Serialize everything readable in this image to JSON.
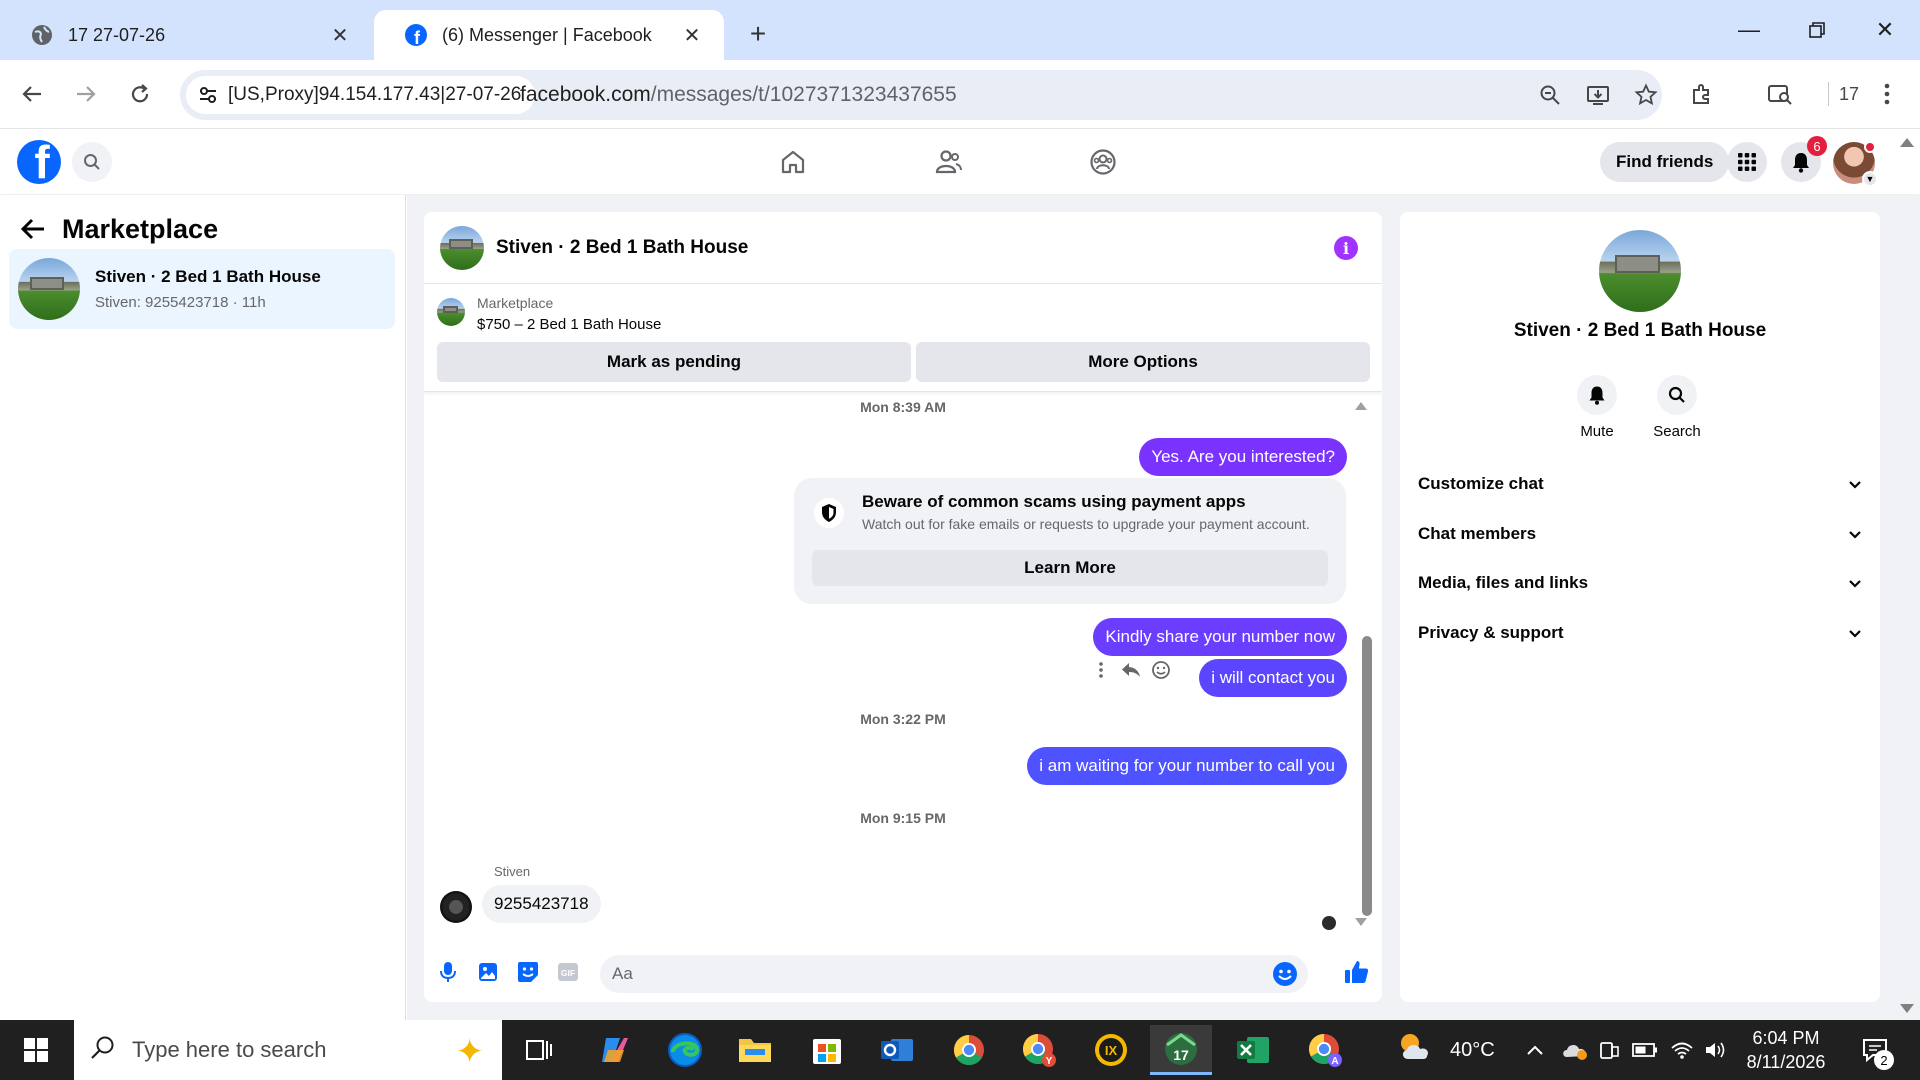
{
  "browser": {
    "tabs": [
      {
        "title": "17 27-07-26",
        "icon": "globe-icon"
      },
      {
        "title": "(6) Messenger | Facebook",
        "icon": "facebook-icon"
      }
    ],
    "omnibox": {
      "proxy_label": "[US,Proxy]94.154.177.43|27-07-26",
      "url_domain": "facebook.com",
      "url_path": "/messages/t/1027371323437655"
    },
    "profile_count": "17"
  },
  "facebook_header": {
    "find_friends_label": "Find friends",
    "notification_count": "6"
  },
  "sidebar": {
    "title": "Marketplace",
    "conversations": [
      {
        "name": "Stiven · 2 Bed 1 Bath House",
        "preview": "Stiven: 9255423718 · 11h"
      }
    ]
  },
  "chat": {
    "header_name": "Stiven · 2 Bed 1 Bath House",
    "marketplace_label": "Marketplace",
    "listing": "$750 – 2 Bed 1 Bath House",
    "mark_pending_label": "Mark as pending",
    "more_options_label": "More Options",
    "timestamps": [
      "Mon 8:39 AM",
      "Mon 3:22 PM",
      "Mon 9:15 PM"
    ],
    "messages_out": [
      "Yes. Are you interested?",
      "Kindly share your number now",
      "i will contact you",
      "i am waiting for your number to call you"
    ],
    "safety_notice": {
      "title": "Beware of common scams using payment apps",
      "text": "Watch out for fake emails or requests to upgrade your payment account.",
      "button": "Learn More"
    },
    "incoming": {
      "sender": "Stiven",
      "text": "9255423718"
    },
    "composer_placeholder": "Aa"
  },
  "info_panel": {
    "name": "Stiven · 2 Bed 1 Bath House",
    "mute_label": "Mute",
    "search_label": "Search",
    "sections": [
      "Customize chat",
      "Chat members",
      "Media, files and links",
      "Privacy & support"
    ]
  },
  "taskbar": {
    "search_placeholder": "Type here to search",
    "temperature": "40°C",
    "time": "6:04 PM",
    "date": "8/11/2026",
    "notification_count": "2",
    "pinned_badge": "17"
  },
  "colors": {
    "facebook_blue": "#0866ff",
    "messenger_purple": "#7a33ff",
    "tab_strip": "#d3e3fd"
  }
}
